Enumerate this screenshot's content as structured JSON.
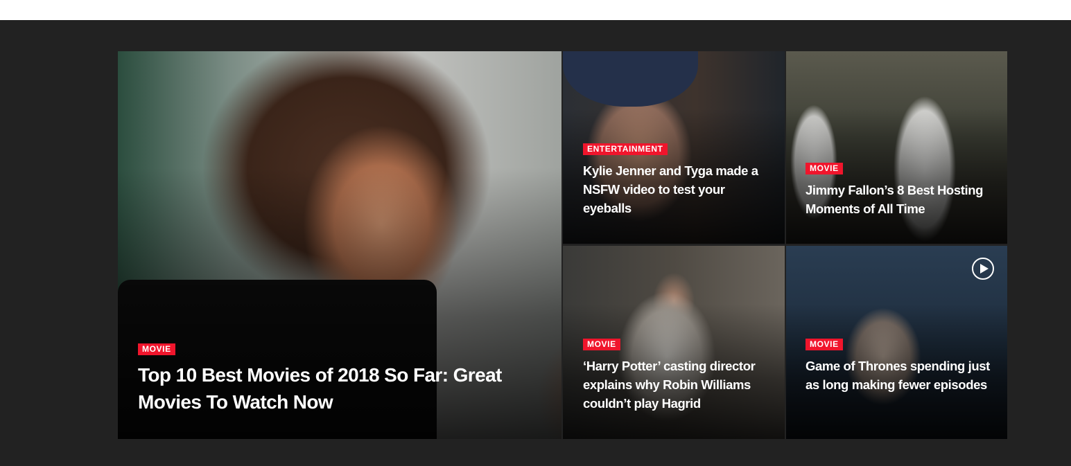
{
  "featured": {
    "category": "MOVIE",
    "title": "Top 10 Best Movies of 2018 So Far: Great Movies To Watch Now",
    "image_icon": "woman-laughing-image"
  },
  "tiles": [
    {
      "category": "ENTERTAINMENT",
      "title": "Kylie Jenner and Tyga made a NSFW video to test your eyeballs",
      "image_icon": "man-in-beret-image"
    },
    {
      "category": "MOVIE",
      "title": "Jimmy Fallon’s 8 Best Hosting Moments of All Time",
      "image_icon": "stormtroopers-image"
    },
    {
      "category": "MOVIE",
      "title": "‘Harry Potter’ casting director explains why Robin Williams couldn’t play Hagrid",
      "image_icon": "woman-sitting-image"
    },
    {
      "category": "MOVIE",
      "title": "Game of Thrones spending just as long making fewer episodes",
      "image_icon": "old-man-image",
      "has_video": true,
      "video_icon": "play-circle-icon"
    }
  ],
  "colors": {
    "band_background": "#222222",
    "badge_background": "#f0152c",
    "title_text": "#ffffff"
  }
}
